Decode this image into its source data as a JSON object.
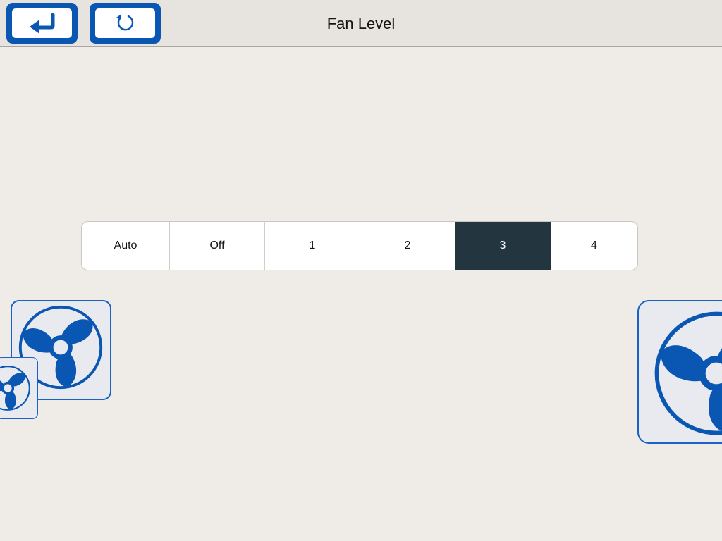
{
  "header": {
    "title": "Fan Level",
    "back_icon": "return-arrow-icon",
    "refresh_icon": "refresh-icon"
  },
  "fan_level": {
    "options": [
      "Auto",
      "Off",
      "1",
      "2",
      "3",
      "4"
    ],
    "selected": "3"
  },
  "colors": {
    "accent": "#0a56b3",
    "selected_segment": "#233640",
    "background": "#efece8",
    "header_background": "#e7e4e0",
    "tile_background": "#e8eaf0"
  },
  "icons": [
    "fan-icon",
    "fan-icon",
    "fan-icon"
  ]
}
